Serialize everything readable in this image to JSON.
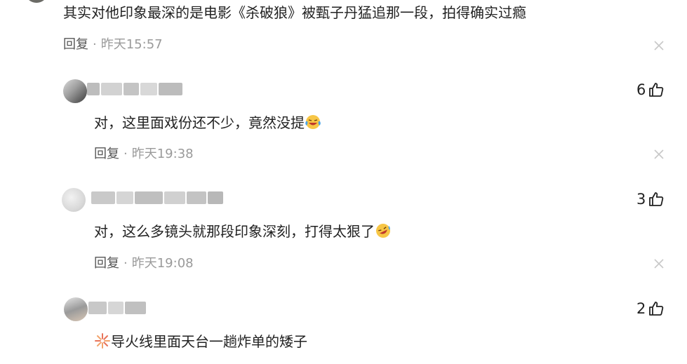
{
  "comments": [
    {
      "text": "其实对他印象最深的是电影《杀破狼》被甄子丹猛追那一段，拍得确实过瘾",
      "reply_label": "回复",
      "separator": "·",
      "time": "昨天15:57"
    },
    {
      "text": "对，这里面戏份还不少，竟然没提",
      "emoji": "laughing-crying-emoji",
      "reply_label": "回复",
      "separator": "·",
      "time": "昨天19:38",
      "likes": "6"
    },
    {
      "text": "对，这么多镜头就那段印象深刻，打得太狠了",
      "emoji": "rofl-emoji",
      "reply_label": "回复",
      "separator": "·",
      "time": "昨天19:08",
      "likes": "3"
    },
    {
      "text": "导火线里面天台一趟炸单的矮子",
      "emoji": "firework-emoji",
      "likes": "2"
    }
  ],
  "icons": {
    "like": "thumbs-up-icon",
    "close": "close-icon"
  },
  "colors": {
    "text": "#222222",
    "meta": "#9a9a9a",
    "close": "#c8c8c8"
  }
}
